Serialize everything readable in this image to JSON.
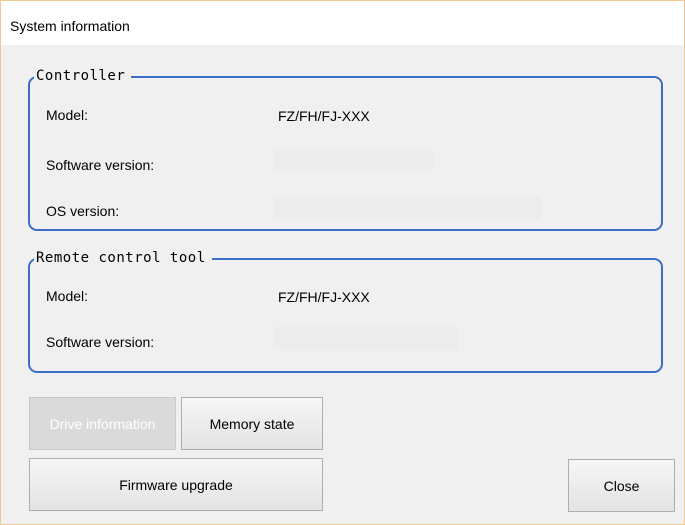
{
  "window": {
    "title": "System information"
  },
  "controller": {
    "legend": "Controller",
    "model_label": "Model:",
    "model_value": "FZ/FH/FJ-XXX",
    "software_label": "Software version:",
    "os_label": "OS version:"
  },
  "remote": {
    "legend": "Remote control tool",
    "model_label": "Model:",
    "model_value": "FZ/FH/FJ-XXX",
    "software_label": "Software version:"
  },
  "buttons": {
    "drive_info": "Drive information",
    "memory_state": "Memory state",
    "firmware_upgrade": "Firmware upgrade",
    "close": "Close"
  }
}
